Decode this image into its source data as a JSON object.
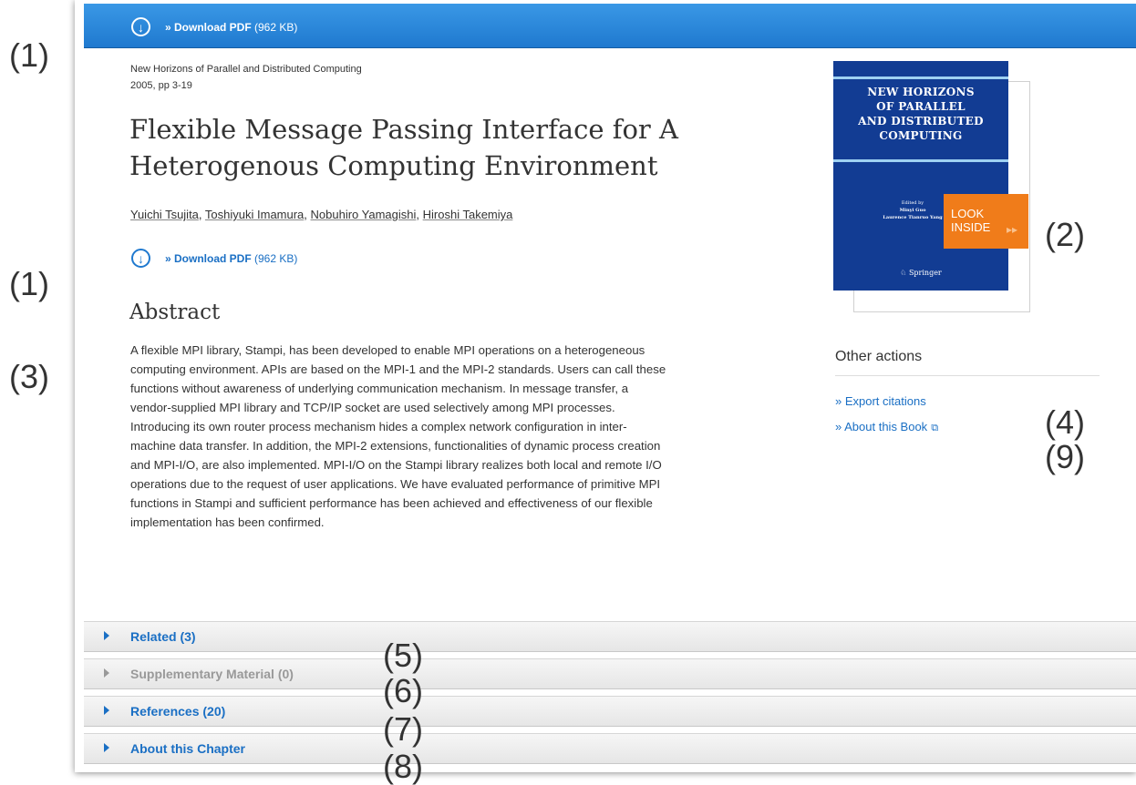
{
  "download": {
    "prefix": "» Download PDF",
    "size": "(962 KB)",
    "icon": "download-circle-icon"
  },
  "chapter": {
    "book_title": "New Horizons of Parallel and Distributed Computing",
    "year_pages": "2005, pp 3-19",
    "title_line1": "Flexible Message Passing Interface for A",
    "title_line2": "Heterogenous Computing Environment",
    "authors": [
      "Yuichi Tsujita",
      "Toshiyuki Imamura",
      "Nobuhiro Yamagishi",
      "Hiroshi Takemiya"
    ],
    "abstract_heading": "Abstract",
    "abstract_lines": [
      "A flexible MPI library, Stampi, has been developed to enable MPI operations on a heterogeneous",
      "computing environment. APIs are based on the MPI-1 and the MPI-2 standards. Users can call these",
      "functions without awareness of underlying communication mechanism. In message transfer, a",
      "vendor-supplied MPI library and TCP/IP socket are used selectively among MPI processes.",
      "Introducing its own router process mechanism hides a complex network configuration in inter-",
      "machine data transfer. In addition, the MPI-2 extensions, functionalities of dynamic process creation",
      "and MPI-I/O, are also implemented. MPI-I/O on the Stampi library realizes both local and remote I/O",
      "operations due to the request of user applications. We have evaluated performance of primitive MPI",
      "functions in Stampi and sufficient performance has been achieved and effectiveness of our flexible",
      "implementation has been confirmed."
    ]
  },
  "cover": {
    "title_lines": [
      "NEW HORIZONS",
      "OF PARALLEL",
      "AND DISTRIBUTED",
      "COMPUTING"
    ],
    "edited_by": "Edited by",
    "editor1": "Minyi Guo",
    "editor2": "Laurence Tianruo Yang",
    "publisher": "Springer",
    "look_inside_line1": "LOOK",
    "look_inside_line2": "INSIDE",
    "arrows": "▸▸",
    "colors": {
      "cover_bg": "#123c93",
      "look_inside_bg": "#f07c1a",
      "topbar": "#1f79cf"
    }
  },
  "other_actions": {
    "heading": "Other actions",
    "export": "» Export citations",
    "about_book": "» About this Book",
    "external_icon": "⧉"
  },
  "accordion": [
    {
      "label": "Related (3)",
      "enabled": true
    },
    {
      "label": "Supplementary Material (0)",
      "enabled": false
    },
    {
      "label": "References (20)",
      "enabled": true
    },
    {
      "label": "About this Chapter",
      "enabled": true
    }
  ],
  "callouts": {
    "c1a": "(1)",
    "c1b": "(1)",
    "c2": "(2)",
    "c3": "(3)",
    "c4": "(4)",
    "c5": "(5)",
    "c6": "(6)",
    "c7": "(7)",
    "c8": "(8)",
    "c9": "(9)"
  }
}
